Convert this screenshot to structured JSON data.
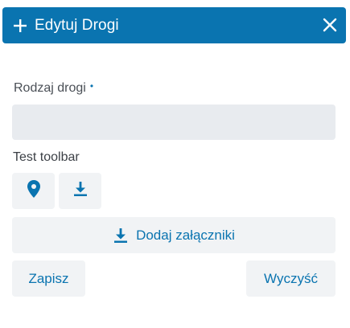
{
  "dialog": {
    "title": "Edytuj Drogi",
    "icons": {
      "add": "plus-icon",
      "close": "close-icon"
    }
  },
  "form": {
    "road_type_label": "Rodzaj drogi",
    "required_marker": "•",
    "road_type_value": "",
    "road_type_placeholder": ""
  },
  "toolbar": {
    "label": "Test toolbar",
    "buttons": [
      {
        "icon": "map-pin-icon"
      },
      {
        "icon": "download-icon"
      }
    ]
  },
  "attachments": {
    "label": "Dodaj załączniki",
    "icon": "download-icon"
  },
  "actions": {
    "save_label": "Zapisz",
    "clear_label": "Wyczyść"
  },
  "colors": {
    "accent": "#0a74b0",
    "button_bg": "#f1f3f5",
    "input_bg": "#e8ebef"
  }
}
